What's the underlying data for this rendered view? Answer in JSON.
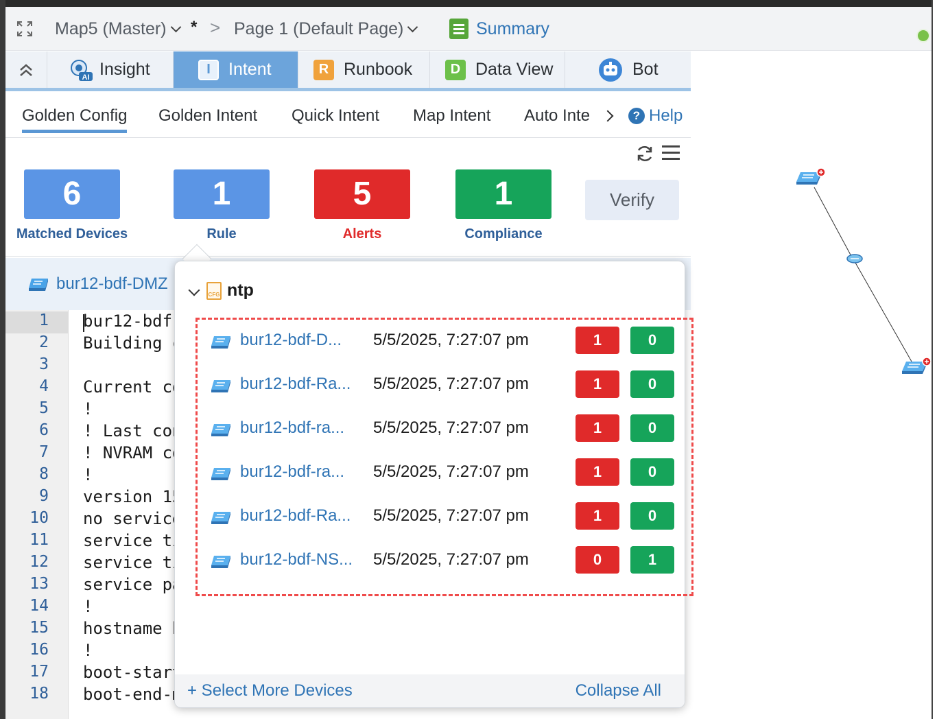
{
  "breadcrumb": {
    "map_label": "Map5 (Master)",
    "dirty_marker": "*",
    "separator": ">",
    "page_label": "Page 1  (Default Page)",
    "summary_label": "Summary"
  },
  "main_tabs": [
    {
      "label": "Insight",
      "icon": "insight-ai-icon"
    },
    {
      "label": "Intent",
      "icon": "intent-icon",
      "icon_text": "I",
      "active": true
    },
    {
      "label": "Runbook",
      "icon": "runbook-icon",
      "icon_text": "R"
    },
    {
      "label": "Data View",
      "icon": "data-view-icon",
      "icon_text": "D"
    },
    {
      "label": "Bot",
      "icon": "bot-icon"
    }
  ],
  "sub_tabs": [
    {
      "label": "Golden Config",
      "active": true
    },
    {
      "label": "Golden Intent"
    },
    {
      "label": "Quick Intent"
    },
    {
      "label": "Map Intent"
    },
    {
      "label": "Auto Inte"
    }
  ],
  "help_label": "Help",
  "stats": [
    {
      "value": "6",
      "label": "Matched Devices",
      "color": "#5b95e5"
    },
    {
      "value": "1",
      "label": "Rule",
      "color": "#5b95e5"
    },
    {
      "value": "5",
      "label": "Alerts",
      "color": "#e02a2a"
    },
    {
      "value": "1",
      "label": "Compliance",
      "color": "#16a45a"
    }
  ],
  "verify_label": "Verify",
  "device_header": "bur12-bdf-DMZ",
  "editor": {
    "line_numbers": [
      "1",
      "2",
      "3",
      "4",
      "5",
      "6",
      "7",
      "8",
      "9",
      "10",
      "11",
      "12",
      "13",
      "14",
      "15",
      "16",
      "17",
      "18"
    ],
    "lines": [
      "bur12-bdf-",
      "Building c",
      "",
      "Current co",
      "!",
      "! Last con",
      "! NVRAM co",
      "!",
      "version 15",
      "no service",
      "service ti",
      "service ti",
      "service pa",
      "!",
      "hostname b",
      "!",
      "boot-start",
      "boot-end-m"
    ]
  },
  "popup": {
    "rule_name": "ntp",
    "rule_icon_text": "CFG",
    "results": [
      {
        "device": "bur12-bdf-D...",
        "time": "5/5/2025, 7:27:07 pm",
        "alerts": "1",
        "compliance": "0"
      },
      {
        "device": "bur12-bdf-Ra...",
        "time": "5/5/2025, 7:27:07 pm",
        "alerts": "1",
        "compliance": "0"
      },
      {
        "device": "bur12-bdf-ra...",
        "time": "5/5/2025, 7:27:07 pm",
        "alerts": "1",
        "compliance": "0"
      },
      {
        "device": "bur12-bdf-ra...",
        "time": "5/5/2025, 7:27:07 pm",
        "alerts": "1",
        "compliance": "0"
      },
      {
        "device": "bur12-bdf-Ra...",
        "time": "5/5/2025, 7:27:07 pm",
        "alerts": "1",
        "compliance": "0"
      },
      {
        "device": "bur12-bdf-NS...",
        "time": "5/5/2025, 7:27:07 pm",
        "alerts": "0",
        "compliance": "1"
      }
    ],
    "select_more_label": "+ Select More Devices",
    "collapse_all_label": "Collapse All"
  },
  "colors": {
    "accent_blue": "#2f74b5",
    "alert_red": "#e02a2a",
    "compliance_green": "#16a45a",
    "highlight_dash": "#ef4b4b"
  }
}
